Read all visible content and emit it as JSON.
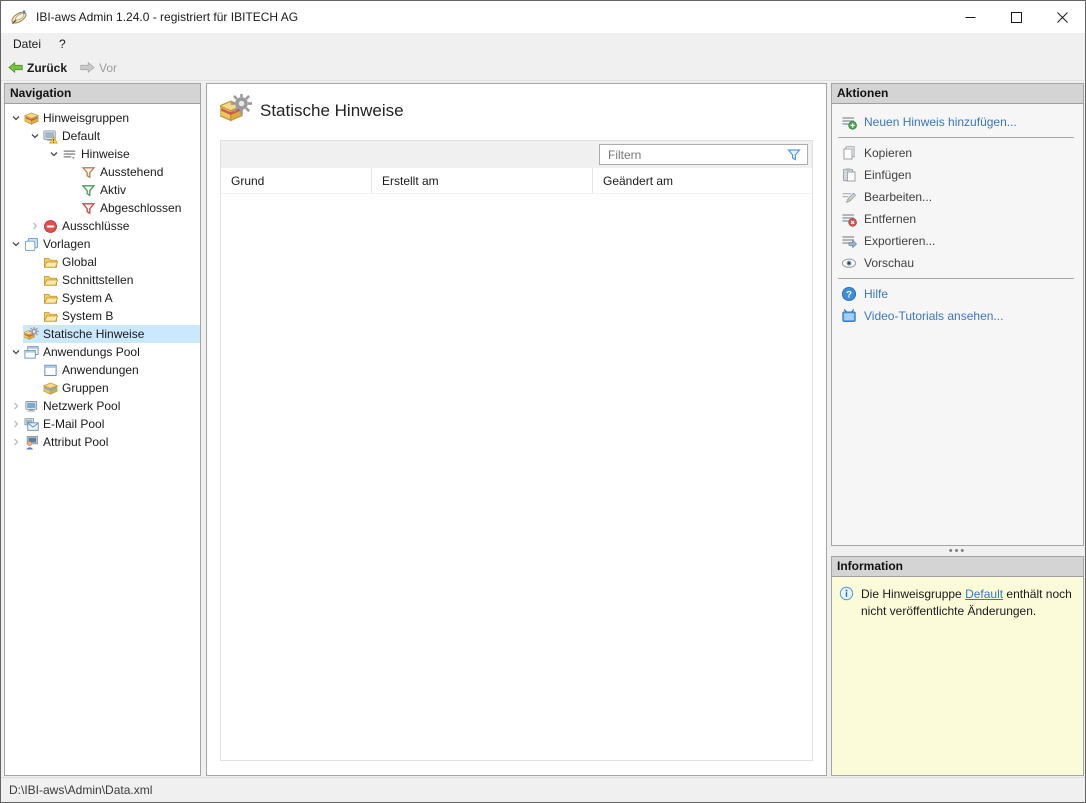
{
  "window": {
    "title": "IBI-aws Admin 1.24.0 - registriert für IBITECH AG",
    "controls": {
      "minimize": "minimize",
      "maximize": "maximize",
      "close": "close"
    }
  },
  "menu": {
    "items": [
      "Datei",
      "?"
    ]
  },
  "toolbar": {
    "back": {
      "label": "Zurück",
      "icon": "back-arrow-icon",
      "enabled": true
    },
    "forward": {
      "label": "Vor",
      "icon": "forward-arrow-icon",
      "enabled": false
    }
  },
  "navigation": {
    "header": "Navigation",
    "tree": [
      {
        "label": "Hinweisgruppen",
        "level": 0,
        "icon": "notice-group-icon",
        "state": "expanded"
      },
      {
        "label": "Default",
        "level": 1,
        "icon": "monitor-warning-icon",
        "state": "expanded"
      },
      {
        "label": "Hinweise",
        "level": 2,
        "icon": "notes-icon",
        "state": "expanded"
      },
      {
        "label": "Ausstehend",
        "level": 3,
        "icon": "funnel-orange-icon",
        "state": "leaf"
      },
      {
        "label": "Aktiv",
        "level": 3,
        "icon": "funnel-green-icon",
        "state": "leaf"
      },
      {
        "label": "Abgeschlossen",
        "level": 3,
        "icon": "funnel-red-icon",
        "state": "leaf"
      },
      {
        "label": "Ausschlüsse",
        "level": 1,
        "icon": "no-entry-icon",
        "state": "collapsed"
      },
      {
        "label": "Vorlagen",
        "level": 0,
        "icon": "templates-icon",
        "state": "expanded"
      },
      {
        "label": "Global",
        "level": 1,
        "icon": "folder-icon",
        "state": "leaf"
      },
      {
        "label": "Schnittstellen",
        "level": 1,
        "icon": "folder-icon",
        "state": "leaf"
      },
      {
        "label": "System A",
        "level": 1,
        "icon": "folder-icon",
        "state": "leaf"
      },
      {
        "label": "System B",
        "level": 1,
        "icon": "folder-icon",
        "state": "leaf"
      },
      {
        "label": "Statische Hinweise",
        "level": 0,
        "icon": "static-notice-icon",
        "state": "leaf",
        "selected": true
      },
      {
        "label": "Anwendungs Pool",
        "level": 0,
        "icon": "app-windows-icon",
        "state": "expanded"
      },
      {
        "label": "Anwendungen",
        "level": 1,
        "icon": "app-window-icon",
        "state": "leaf"
      },
      {
        "label": "Gruppen",
        "level": 1,
        "icon": "group-box-icon",
        "state": "leaf"
      },
      {
        "label": "Netzwerk Pool",
        "level": 0,
        "icon": "network-icon",
        "state": "collapsed"
      },
      {
        "label": "E-Mail Pool",
        "level": 0,
        "icon": "email-icon",
        "state": "collapsed"
      },
      {
        "label": "Attribut Pool",
        "level": 0,
        "icon": "attribute-icon",
        "state": "collapsed"
      }
    ]
  },
  "main": {
    "title": "Statische Hinweise",
    "title_icon": "static-notice-icon",
    "filter": {
      "placeholder": "Filtern",
      "icon": "filter-funnel-icon"
    },
    "table": {
      "columns": [
        "Grund",
        "Erstellt am",
        "Geändert am"
      ],
      "rows": []
    }
  },
  "actions": {
    "header": "Aktionen",
    "items": [
      {
        "label": "Neuen Hinweis hinzufügen...",
        "icon": "add-notice-icon",
        "type": "link"
      },
      {
        "type": "separator"
      },
      {
        "label": "Kopieren",
        "icon": "copy-icon",
        "type": "plain"
      },
      {
        "label": "Einfügen",
        "icon": "paste-icon",
        "type": "plain"
      },
      {
        "label": "Bearbeiten...",
        "icon": "edit-icon",
        "type": "plain"
      },
      {
        "label": "Entfernen",
        "icon": "remove-icon",
        "type": "plain"
      },
      {
        "label": "Exportieren...",
        "icon": "export-icon",
        "type": "plain"
      },
      {
        "label": "Vorschau",
        "icon": "preview-icon",
        "type": "plain"
      },
      {
        "type": "separator"
      },
      {
        "label": "Hilfe",
        "icon": "help-icon",
        "type": "link"
      },
      {
        "label": "Video-Tutorials ansehen...",
        "icon": "video-icon",
        "type": "link"
      }
    ]
  },
  "information": {
    "header": "Information",
    "icon": "info-icon",
    "text_before": "Die Hinweisgruppe ",
    "link": "Default",
    "text_after": " enthält noch nicht veröffentlichte Änderungen."
  },
  "statusbar": {
    "path": "D:\\IBI-aws\\Admin\\Data.xml"
  },
  "colors": {
    "link_blue": "#3b77bd",
    "selection_blue": "#cce8ff",
    "info_yellow": "#fbfbd9",
    "panel_header_gray": "#d4d4d4",
    "back_arrow_green": "#7ac143"
  }
}
